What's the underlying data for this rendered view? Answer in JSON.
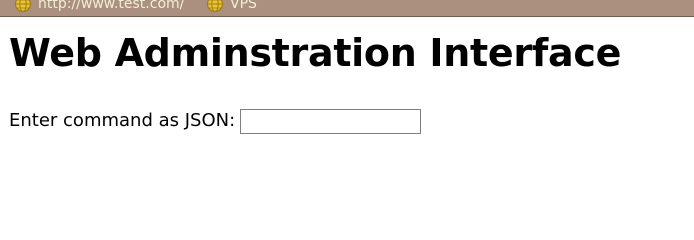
{
  "bookmarks_bar": {
    "items": [
      {
        "label": "http://www.test.com/",
        "icon": "globe-icon"
      },
      {
        "label": "VPS",
        "icon": "globe-icon"
      }
    ]
  },
  "page": {
    "title": "Web Adminstration Interface",
    "command_label": "Enter command as JSON:",
    "command_value": ""
  }
}
